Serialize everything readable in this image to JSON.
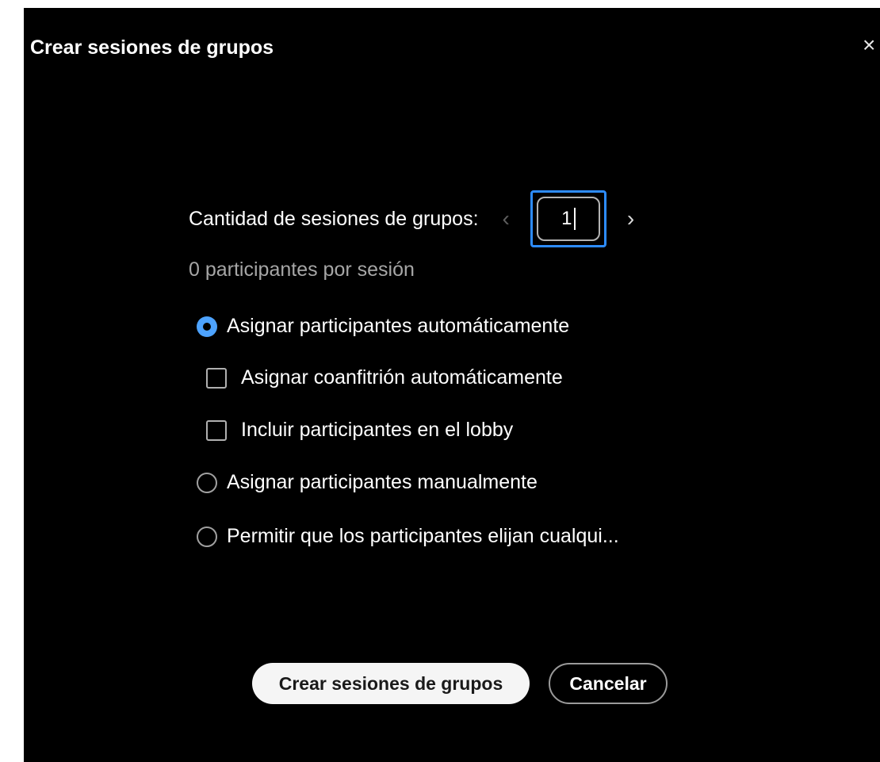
{
  "dialog": {
    "title": "Crear sesiones de grupos",
    "close_glyph": "×"
  },
  "room_count": {
    "label": "Cantidad de sesiones de grupos:",
    "value": "1",
    "decrement_glyph": "‹",
    "increment_glyph": "›"
  },
  "participants_per_room": "0 participantes por sesión",
  "options": {
    "assign_auto": {
      "label": "Asignar participantes automáticamente",
      "selected": true
    },
    "auto_cohost": {
      "label": "Asignar coanfitrión automáticamente",
      "checked": false
    },
    "include_lobby": {
      "label": "Incluir participantes en el lobby",
      "checked": false
    },
    "assign_manual": {
      "label": "Asignar participantes manualmente",
      "selected": false
    },
    "let_choose": {
      "label": "Permitir que los participantes elijan cualqui...",
      "selected": false
    }
  },
  "buttons": {
    "create": "Crear sesiones de grupos",
    "cancel": "Cancelar"
  },
  "colors": {
    "background": "#000000",
    "accent": "#2d8cff",
    "radio_selected": "#4da3ff"
  }
}
